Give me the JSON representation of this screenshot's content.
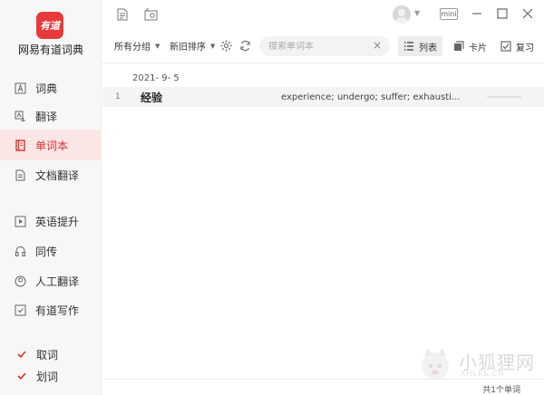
{
  "app": {
    "logo_text": "有道",
    "name": "网易有道词典"
  },
  "sidebar": {
    "items": [
      {
        "label": "词典",
        "icon": "dictionary-icon"
      },
      {
        "label": "翻译",
        "icon": "translate-icon"
      },
      {
        "label": "单词本",
        "icon": "wordbook-icon",
        "active": true
      },
      {
        "label": "文档翻译",
        "icon": "document-icon"
      },
      {
        "label": "英语提升",
        "icon": "play-icon"
      },
      {
        "label": "同传",
        "icon": "headset-icon"
      },
      {
        "label": "人工翻译",
        "icon": "person-icon"
      },
      {
        "label": "有道写作",
        "icon": "writing-icon"
      }
    ],
    "toggles": [
      {
        "label": "取词",
        "checked": true
      },
      {
        "label": "划词",
        "checked": true
      }
    ]
  },
  "topbar": {
    "mini_label": "mini"
  },
  "toolbar": {
    "group_dropdown": "所有分组",
    "sort_dropdown": "新旧排序",
    "search_placeholder": "搜索单词本",
    "view_list": "列表",
    "view_card": "卡片",
    "review": "复习"
  },
  "wordbook": {
    "date": "2021- 9- 5",
    "entries": [
      {
        "index": "1",
        "word": "经验",
        "definition": "experience;  undergo;  suffer;  exhausti..."
      }
    ]
  },
  "footer": {
    "count_text": "共1个单词"
  },
  "watermark": {
    "cn": "小狐狸网",
    "en": "XHLKS.CN"
  },
  "colors": {
    "accent": "#d9312f",
    "logo_bg": "#e83a3a",
    "active_bg": "#fbe6e6"
  }
}
